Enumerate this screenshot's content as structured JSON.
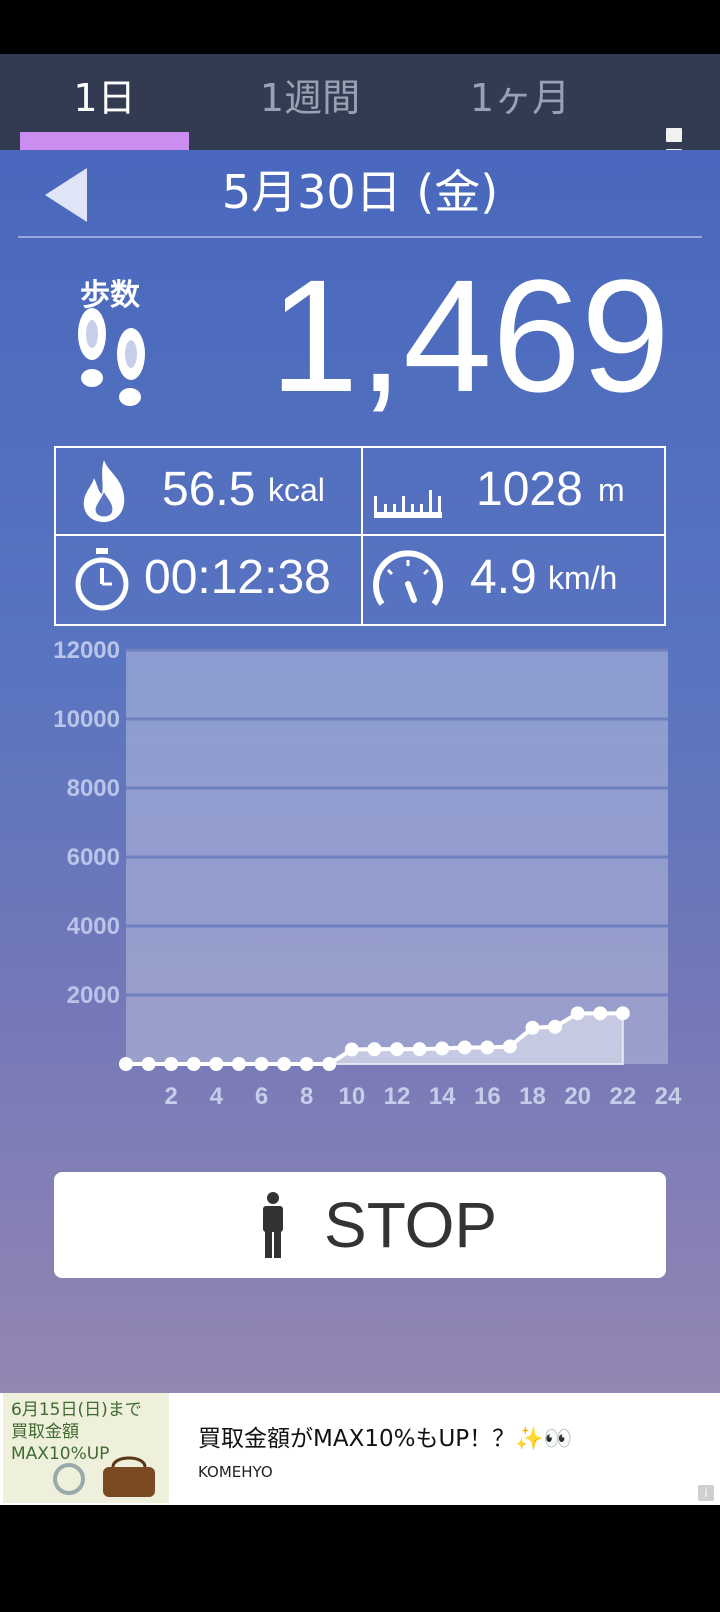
{
  "tabs": [
    {
      "label": "1日"
    },
    {
      "label": "1週間"
    },
    {
      "label": "1ヶ月"
    }
  ],
  "colors": {
    "header_bg": "#333b52",
    "tab_indicator": "#cc8df0",
    "gradient_top": "#4968bd",
    "gradient_bottom": "#9486b3",
    "chart_area": "#b6bedc"
  },
  "icons": {
    "back": "back-arrow-icon",
    "menu": "more-vertical-icon",
    "footsteps": "footsteps-icon",
    "calories": "flame-icon",
    "distance": "ruler-icon",
    "time": "stopwatch-icon",
    "speed": "speedometer-icon",
    "walker": "person-icon"
  },
  "date": {
    "label": "5月30日 (金)"
  },
  "steps": {
    "label": "歩数",
    "value": "1,469"
  },
  "stats": {
    "calories": {
      "value": "56.5",
      "unit": "kcal"
    },
    "distance": {
      "value": "1028",
      "unit": "m"
    },
    "time": {
      "value": "00:12:38"
    },
    "speed": {
      "value": "4.9",
      "unit": "km/h"
    }
  },
  "chart_data": {
    "type": "area",
    "x": [
      0,
      1,
      2,
      3,
      4,
      5,
      6,
      7,
      8,
      9,
      10,
      11,
      12,
      13,
      14,
      15,
      16,
      17,
      18,
      19,
      20,
      21,
      22
    ],
    "values": [
      0,
      0,
      0,
      0,
      0,
      0,
      0,
      0,
      0,
      0,
      420,
      430,
      430,
      430,
      450,
      480,
      480,
      510,
      1050,
      1080,
      1469,
      1469,
      1469
    ],
    "xticks": [
      "2",
      "4",
      "6",
      "8",
      "10",
      "12",
      "14",
      "16",
      "18",
      "20",
      "22",
      "24"
    ],
    "yticks": [
      "12000",
      "10000",
      "8000",
      "6000",
      "4000",
      "2000"
    ],
    "xlim": [
      0,
      24
    ],
    "ylim": [
      0,
      12000
    ],
    "grid": true
  },
  "stop_button": {
    "label": "STOP"
  },
  "ad": {
    "image_text": "6月15日(日)まで 買取金額MAX10%UP",
    "title": "買取金額がMAX10%もUP！？✨👀",
    "advertiser": "KOMEHYO",
    "info": "i"
  }
}
